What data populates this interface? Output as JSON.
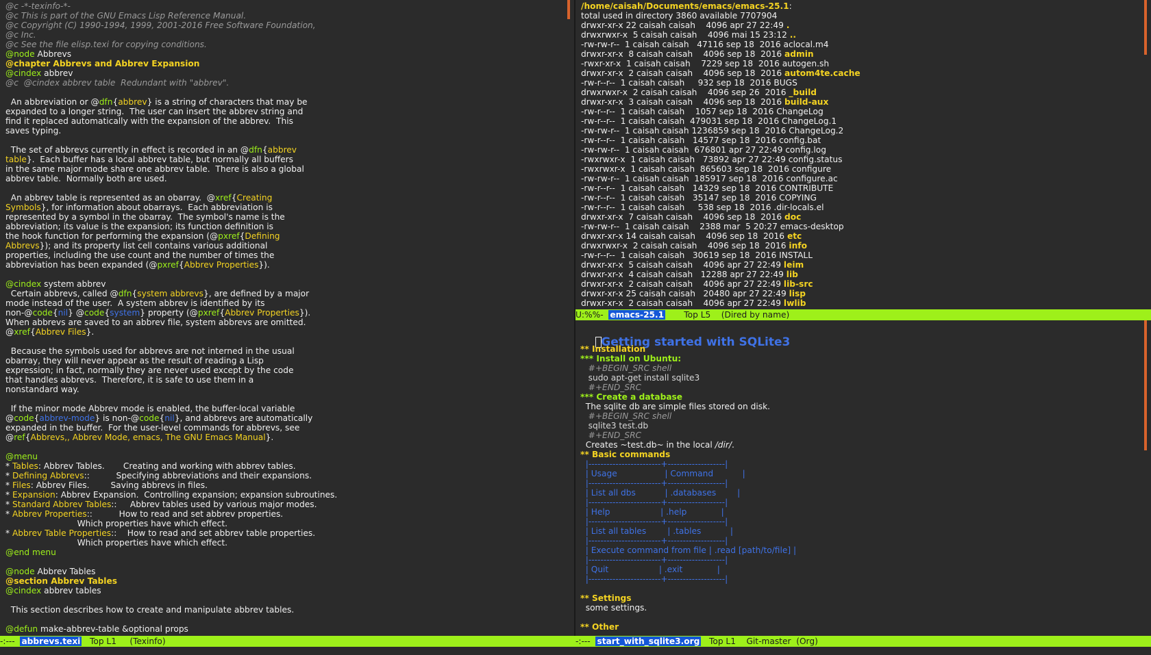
{
  "left": {
    "lines": [
      [
        {
          "t": "@c -*-texinfo-*-",
          "c": "c-comment"
        }
      ],
      [
        {
          "t": "@c This is part of the GNU Emacs Lisp Reference Manual.",
          "c": "c-comment"
        }
      ],
      [
        {
          "t": "@c Copyright (C) 1990-1994, 1999, 2001-2016 Free Software Foundation,",
          "c": "c-comment"
        }
      ],
      [
        {
          "t": "@c Inc.",
          "c": "c-comment"
        }
      ],
      [
        {
          "t": "@c See the file elisp.texi for copying conditions.",
          "c": "c-comment"
        }
      ],
      [
        {
          "t": "@node",
          "c": "c-kw"
        },
        {
          "t": " Abbrevs"
        }
      ],
      [
        {
          "t": "@chapter Abbrevs and Abbrev Expansion",
          "c": "c-head"
        }
      ],
      [
        {
          "t": "@cindex",
          "c": "c-kw"
        },
        {
          "t": " abbrev"
        }
      ],
      [
        {
          "t": "@c  @cindex abbrev table  Redundant with \"abbrev\".",
          "c": "c-comment"
        }
      ],
      [
        {
          "t": ""
        }
      ],
      [
        {
          "t": "  An abbreviation or @"
        },
        {
          "t": "dfn",
          "c": "c-kw"
        },
        {
          "t": "{"
        },
        {
          "t": "abbrev",
          "c": "c-arg"
        },
        {
          "t": "} is a string of characters that may be"
        }
      ],
      [
        {
          "t": "expanded to a longer string.  The user can insert the abbrev string and"
        }
      ],
      [
        {
          "t": "find it replaced automatically with the expansion of the abbrev.  This"
        }
      ],
      [
        {
          "t": "saves typing."
        }
      ],
      [
        {
          "t": ""
        }
      ],
      [
        {
          "t": "  The set of abbrevs currently in effect is recorded in an @"
        },
        {
          "t": "dfn",
          "c": "c-kw"
        },
        {
          "t": "{"
        },
        {
          "t": "abbrev",
          "c": "c-arg"
        }
      ],
      [
        {
          "t": "table",
          "c": "c-arg"
        },
        {
          "t": "}.  Each buffer has a local abbrev table, but normally all buffers"
        }
      ],
      [
        {
          "t": "in the same major mode share one abbrev table.  There is also a global"
        }
      ],
      [
        {
          "t": "abbrev table.  Normally both are used."
        }
      ],
      [
        {
          "t": ""
        }
      ],
      [
        {
          "t": "  An abbrev table is represented as an obarray.  @"
        },
        {
          "t": "xref",
          "c": "c-kw"
        },
        {
          "t": "{"
        },
        {
          "t": "Creating",
          "c": "c-arg"
        }
      ],
      [
        {
          "t": "Symbols",
          "c": "c-arg"
        },
        {
          "t": "}, for information about obarrays.  Each abbreviation is"
        }
      ],
      [
        {
          "t": "represented by a symbol in the obarray.  The symbol's name is the"
        }
      ],
      [
        {
          "t": "abbreviation; its value is the expansion; its function definition is"
        }
      ],
      [
        {
          "t": "the hook function for performing the expansion (@"
        },
        {
          "t": "pxref",
          "c": "c-kw"
        },
        {
          "t": "{"
        },
        {
          "t": "Defining",
          "c": "c-arg"
        }
      ],
      [
        {
          "t": "Abbrevs",
          "c": "c-arg"
        },
        {
          "t": "}); and its property list cell contains various additional"
        }
      ],
      [
        {
          "t": "properties, including the use count and the number of times the"
        }
      ],
      [
        {
          "t": "abbreviation has been expanded (@"
        },
        {
          "t": "pxref",
          "c": "c-kw"
        },
        {
          "t": "{"
        },
        {
          "t": "Abbrev Properties",
          "c": "c-arg"
        },
        {
          "t": "})."
        }
      ],
      [
        {
          "t": ""
        }
      ],
      [
        {
          "t": "@cindex",
          "c": "c-kw"
        },
        {
          "t": " system abbrev"
        }
      ],
      [
        {
          "t": "  Certain abbrevs, called @"
        },
        {
          "t": "dfn",
          "c": "c-kw"
        },
        {
          "t": "{"
        },
        {
          "t": "system abbrevs",
          "c": "c-arg"
        },
        {
          "t": "}, are defined by a major"
        }
      ],
      [
        {
          "t": "mode instead of the user.  A system abbrev is identified by its"
        }
      ],
      [
        {
          "t": "non-@"
        },
        {
          "t": "code",
          "c": "c-kw"
        },
        {
          "t": "{"
        },
        {
          "t": "nil",
          "c": "c-blue"
        },
        {
          "t": "} @"
        },
        {
          "t": "code",
          "c": "c-kw"
        },
        {
          "t": "{"
        },
        {
          "t": "system",
          "c": "c-blue"
        },
        {
          "t": "} property (@"
        },
        {
          "t": "pxref",
          "c": "c-kw"
        },
        {
          "t": "{"
        },
        {
          "t": "Abbrev Properties",
          "c": "c-arg"
        },
        {
          "t": "})."
        }
      ],
      [
        {
          "t": "When abbrevs are saved to an abbrev file, system abbrevs are omitted."
        }
      ],
      [
        {
          "t": "@"
        },
        {
          "t": "xref",
          "c": "c-kw"
        },
        {
          "t": "{"
        },
        {
          "t": "Abbrev Files",
          "c": "c-arg"
        },
        {
          "t": "}."
        }
      ],
      [
        {
          "t": ""
        }
      ],
      [
        {
          "t": "  Because the symbols used for abbrevs are not interned in the usual"
        }
      ],
      [
        {
          "t": "obarray, they will never appear as the result of reading a Lisp"
        }
      ],
      [
        {
          "t": "expression; in fact, normally they are never used except by the code"
        }
      ],
      [
        {
          "t": "that handles abbrevs.  Therefore, it is safe to use them in a"
        }
      ],
      [
        {
          "t": "nonstandard way."
        }
      ],
      [
        {
          "t": ""
        }
      ],
      [
        {
          "t": "  If the minor mode Abbrev mode is enabled, the buffer-local variable"
        }
      ],
      [
        {
          "t": "@"
        },
        {
          "t": "code",
          "c": "c-kw"
        },
        {
          "t": "{"
        },
        {
          "t": "abbrev-mode",
          "c": "c-blue"
        },
        {
          "t": "} is non-@"
        },
        {
          "t": "code",
          "c": "c-kw"
        },
        {
          "t": "{"
        },
        {
          "t": "nil",
          "c": "c-blue"
        },
        {
          "t": "}, and abbrevs are automatically"
        }
      ],
      [
        {
          "t": "expanded in the buffer.  For the user-level commands for abbrevs, see"
        }
      ],
      [
        {
          "t": "@"
        },
        {
          "t": "ref",
          "c": "c-kw"
        },
        {
          "t": "{"
        },
        {
          "t": "Abbrevs,, Abbrev Mode, emacs, The GNU Emacs Manual",
          "c": "c-arg"
        },
        {
          "t": "}."
        }
      ],
      [
        {
          "t": ""
        }
      ],
      [
        {
          "t": "@menu",
          "c": "c-kw"
        }
      ],
      [
        {
          "t": "* "
        },
        {
          "t": "Tables",
          "c": "c-yellow"
        },
        {
          "t": ": Abbrev Tables.       Creating and working with abbrev tables."
        }
      ],
      [
        {
          "t": "* "
        },
        {
          "t": "Defining Abbrevs",
          "c": "c-yellow"
        },
        {
          "t": "::          Specifying abbreviations and their expansions."
        }
      ],
      [
        {
          "t": "* "
        },
        {
          "t": "Files",
          "c": "c-yellow"
        },
        {
          "t": ": Abbrev Files.        Saving abbrevs in files."
        }
      ],
      [
        {
          "t": "* "
        },
        {
          "t": "Expansion",
          "c": "c-yellow"
        },
        {
          "t": ": Abbrev Expansion.  Controlling expansion; expansion subroutines."
        }
      ],
      [
        {
          "t": "* "
        },
        {
          "t": "Standard Abbrev Tables",
          "c": "c-yellow"
        },
        {
          "t": "::     Abbrev tables used by various major modes."
        }
      ],
      [
        {
          "t": "* "
        },
        {
          "t": "Abbrev Properties",
          "c": "c-yellow"
        },
        {
          "t": "::          How to read and set abbrev properties."
        }
      ],
      [
        {
          "t": "                           Which properties have which effect."
        }
      ],
      [
        {
          "t": "* "
        },
        {
          "t": "Abbrev Table Properties",
          "c": "c-yellow"
        },
        {
          "t": "::    How to read and set abbrev table properties."
        }
      ],
      [
        {
          "t": "                           Which properties have which effect."
        }
      ],
      [
        {
          "t": "@end menu",
          "c": "c-kw"
        }
      ],
      [
        {
          "t": ""
        }
      ],
      [
        {
          "t": "@node",
          "c": "c-kw"
        },
        {
          "t": " Abbrev Tables"
        }
      ],
      [
        {
          "t": "@section Abbrev Tables",
          "c": "c-head"
        }
      ],
      [
        {
          "t": "@cindex",
          "c": "c-kw"
        },
        {
          "t": " abbrev tables"
        }
      ],
      [
        {
          "t": ""
        }
      ],
      [
        {
          "t": "  This section describes how to create and manipulate abbrev tables."
        }
      ],
      [
        {
          "t": ""
        }
      ],
      [
        {
          "t": "@defun",
          "c": "c-kw"
        },
        {
          "t": " make-abbrev-table &optional props"
        }
      ]
    ]
  },
  "dired": {
    "lines": [
      [
        {
          "t": "/home/caisah/Documents/emacs/emacs-25.1",
          "c": "c-path"
        },
        {
          "t": ":"
        }
      ],
      [
        {
          "t": "total used in directory 3860 available 7707904"
        }
      ],
      [
        {
          "t": "drwxr-xr-x 22 caisah caisah    4096 apr 27 22:49 "
        },
        {
          "t": ".",
          "c": "c-dir"
        }
      ],
      [
        {
          "t": "drwxrwxr-x  5 caisah caisah    4096 mai 15 23:12 "
        },
        {
          "t": "..",
          "c": "c-dir"
        }
      ],
      [
        {
          "t": "-rw-rw-r--  1 caisah caisah   47116 sep 18  2016 aclocal.m4"
        }
      ],
      [
        {
          "t": "drwxr-xr-x  8 caisah caisah    4096 sep 18  2016 "
        },
        {
          "t": "admin",
          "c": "c-dir"
        }
      ],
      [
        {
          "t": "-rwxr-xr-x  1 caisah caisah    7229 sep 18  2016 autogen.sh"
        }
      ],
      [
        {
          "t": "drwxr-xr-x  2 caisah caisah    4096 sep 18  2016 "
        },
        {
          "t": "autom4te.cache",
          "c": "c-dir"
        }
      ],
      [
        {
          "t": "-rw-r--r--  1 caisah caisah     932 sep 18  2016 BUGS"
        }
      ],
      [
        {
          "t": "drwxrwxr-x  2 caisah caisah    4096 sep 26  2016 "
        },
        {
          "t": "_build",
          "c": "c-dir"
        }
      ],
      [
        {
          "t": "drwxr-xr-x  3 caisah caisah    4096 sep 18  2016 "
        },
        {
          "t": "build-aux",
          "c": "c-dir"
        }
      ],
      [
        {
          "t": "-rw-r--r--  1 caisah caisah    1057 sep 18  2016 ChangeLog"
        }
      ],
      [
        {
          "t": "-rw-r--r--  1 caisah caisah  479031 sep 18  2016 ChangeLog.1"
        }
      ],
      [
        {
          "t": "-rw-rw-r--  1 caisah caisah 1236859 sep 18  2016 ChangeLog.2"
        }
      ],
      [
        {
          "t": "-rw-r--r--  1 caisah caisah   14577 sep 18  2016 config.bat"
        }
      ],
      [
        {
          "t": "-rw-rw-r--  1 caisah caisah  676801 apr 27 22:49 config.log"
        }
      ],
      [
        {
          "t": "-rwxrwxr-x  1 caisah caisah   73892 apr 27 22:49 config.status"
        }
      ],
      [
        {
          "t": "-rwxrwxr-x  1 caisah caisah  865603 sep 18  2016 configure"
        }
      ],
      [
        {
          "t": "-rw-rw-r--  1 caisah caisah  185917 sep 18  2016 configure.ac"
        }
      ],
      [
        {
          "t": "-rw-r--r--  1 caisah caisah   14329 sep 18  2016 CONTRIBUTE"
        }
      ],
      [
        {
          "t": "-rw-r--r--  1 caisah caisah   35147 sep 18  2016 COPYING"
        }
      ],
      [
        {
          "t": "-rw-r--r--  1 caisah caisah     538 sep 18  2016 .dir-locals.el"
        }
      ],
      [
        {
          "t": "drwxr-xr-x  7 caisah caisah    4096 sep 18  2016 "
        },
        {
          "t": "doc",
          "c": "c-dir"
        }
      ],
      [
        {
          "t": "-rw-rw-r--  1 caisah caisah    2388 mar  5 20:27 emacs-desktop"
        }
      ],
      [
        {
          "t": "drwxr-xr-x 14 caisah caisah    4096 sep 18  2016 "
        },
        {
          "t": "etc",
          "c": "c-dir"
        }
      ],
      [
        {
          "t": "drwxrwxr-x  2 caisah caisah    4096 sep 18  2016 "
        },
        {
          "t": "info",
          "c": "c-dir"
        }
      ],
      [
        {
          "t": "-rw-r--r--  1 caisah caisah   30619 sep 18  2016 INSTALL"
        }
      ],
      [
        {
          "t": "drwxr-xr-x  5 caisah caisah    4096 apr 27 22:49 "
        },
        {
          "t": "leim",
          "c": "c-dir"
        }
      ],
      [
        {
          "t": "drwxr-xr-x  4 caisah caisah   12288 apr 27 22:49 "
        },
        {
          "t": "lib",
          "c": "c-dir"
        }
      ],
      [
        {
          "t": "drwxr-xr-x  2 caisah caisah    4096 apr 27 22:49 "
        },
        {
          "t": "lib-src",
          "c": "c-dir"
        }
      ],
      [
        {
          "t": "drwxr-xr-x 25 caisah caisah   20480 apr 27 22:49 "
        },
        {
          "t": "lisp",
          "c": "c-dir"
        }
      ],
      [
        {
          "t": "drwxr-xr-x  2 caisah caisah    4096 apr 27 22:49 "
        },
        {
          "t": "lwlib",
          "c": "c-dir"
        }
      ]
    ]
  },
  "org": {
    "title": "Getting started with SQLite3",
    "lines": [
      [
        {
          "t": ""
        }
      ],
      [
        {
          "t": "** Installation",
          "c": "c-h2"
        }
      ],
      [
        {
          "t": "*** Install on Ubuntu:",
          "c": "c-h3"
        }
      ],
      [
        {
          "t": "   #+BEGIN_SRC shell",
          "c": "c-meta"
        }
      ],
      [
        {
          "t": "   sudo apt-get install sqlite3",
          "c": "c-code"
        }
      ],
      [
        {
          "t": "   #+END_SRC",
          "c": "c-meta"
        }
      ],
      [
        {
          "t": "*** Create a database",
          "c": "c-h3"
        }
      ],
      [
        {
          "t": "  The sqlite db are simple files stored on disk."
        }
      ],
      [
        {
          "t": "   #+BEGIN_SRC shell",
          "c": "c-meta"
        }
      ],
      [
        {
          "t": "   sqlite3 test.db",
          "c": "c-code"
        }
      ],
      [
        {
          "t": "   #+END_SRC",
          "c": "c-meta"
        }
      ],
      [
        {
          "t": "  Creates ~test.db~ in the local "
        },
        {
          "t": "/dir/",
          "c": "c-italic"
        },
        {
          "t": "."
        }
      ],
      [
        {
          "t": "** Basic commands",
          "c": "c-h2"
        }
      ],
      [
        {
          "t": "  |------------------------+-------------------|",
          "c": "c-table"
        }
      ],
      [
        {
          "t": "  | Usage                  | Command           |",
          "c": "c-table"
        }
      ],
      [
        {
          "t": "  |------------------------+-------------------|",
          "c": "c-table"
        }
      ],
      [
        {
          "t": "  | List all dbs           | .databases        |",
          "c": "c-table"
        }
      ],
      [
        {
          "t": "  |------------------------+-------------------|",
          "c": "c-table"
        }
      ],
      [
        {
          "t": "  | Help                   | .help             |",
          "c": "c-table"
        }
      ],
      [
        {
          "t": "  |------------------------+-------------------|",
          "c": "c-table"
        }
      ],
      [
        {
          "t": "  | List all tables        | .tables           |",
          "c": "c-table"
        }
      ],
      [
        {
          "t": "  |------------------------+-------------------|",
          "c": "c-table"
        }
      ],
      [
        {
          "t": "  | Execute command from file | .read [path/to/file] |",
          "c": "c-table"
        }
      ],
      [
        {
          "t": "  |------------------------+-------------------|",
          "c": "c-table"
        }
      ],
      [
        {
          "t": "  | Quit                   | .exit             |",
          "c": "c-table"
        }
      ],
      [
        {
          "t": "  |------------------------+-------------------|",
          "c": "c-table"
        }
      ],
      [
        {
          "t": ""
        }
      ],
      [
        {
          "t": "** Settings",
          "c": "c-h2"
        }
      ],
      [
        {
          "t": "  some settings."
        }
      ],
      [
        {
          "t": ""
        }
      ],
      [
        {
          "t": "** Other",
          "c": "c-h2"
        }
      ]
    ]
  },
  "modelines": {
    "left": {
      "pre": "-:---  ",
      "buffer": "abbrevs.texi",
      "post": "   Top L1     (Texinfo)"
    },
    "dired": {
      "pre": "U:%%-  ",
      "buffer": "emacs-25.1",
      "post": "       Top L5    (Dired by name)"
    },
    "org": {
      "pre": "-:---  ",
      "buffer": "start_with_sqlite3.org",
      "post": "   Top L1    Git-master  (Org)"
    }
  },
  "colors": {
    "background": "#2b2b2b",
    "modeline": "#9ef01a",
    "buffer_name_bg": "#1457d8",
    "keyword": "#9ef01a",
    "heading": "#f4d322",
    "link": "#3f72e6",
    "scrollbar": "#d8632c"
  }
}
